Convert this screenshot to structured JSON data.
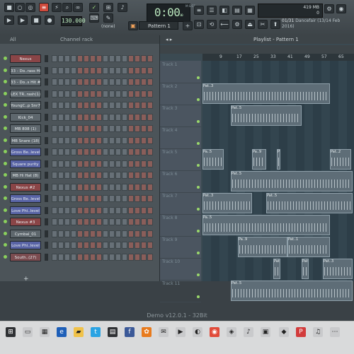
{
  "toolbar": {
    "tempo": "130.000",
    "time_main": "0:00",
    "time_small": "M:S:CS",
    "time_cs": "00",
    "pattern_label": "Pattern 1",
    "none_label": "(none)",
    "cpu_mem": "419 MB",
    "cpu_num": "0",
    "news_count": "01/31",
    "news_title": "Dancefair (13/14 Feb",
    "news_year": "2016)",
    "accent_color": "#d04a3c"
  },
  "channel_rack": {
    "filter_label": "All",
    "title": "Channel rack",
    "channels": [
      {
        "name": "Nexus",
        "color": "#8a4547"
      },
      {
        "name": "33 - Do..rass Hit",
        "color": "#5e676d"
      },
      {
        "name": "33 - Do..s Hit #2",
        "color": "#5e676d"
      },
      {
        "name": "LEX TR..rash(1)",
        "color": "#5e676d"
      },
      {
        "name": "YoungC..p Snr7",
        "color": "#5e676d"
      },
      {
        "name": "Kick_04",
        "color": "#5e676d"
      },
      {
        "name": "MB 808 (1)",
        "color": "#5e676d"
      },
      {
        "name": "MB Snare (18)",
        "color": "#5e676d"
      },
      {
        "name": "Gross Be..level",
        "color": "#5964a6"
      },
      {
        "name": "Square purity",
        "color": "#5964a6"
      },
      {
        "name": "MB Hi Hat (8)",
        "color": "#5e676d"
      },
      {
        "name": "Nexus #2",
        "color": "#8a4547"
      },
      {
        "name": "Gross Be..level",
        "color": "#5964a6"
      },
      {
        "name": "Love Phi..level",
        "color": "#5964a6"
      },
      {
        "name": "Nexus #3",
        "color": "#8a4547"
      },
      {
        "name": "Cymbal_01",
        "color": "#5e676d"
      },
      {
        "name": "Love Phi..level",
        "color": "#5964a6"
      },
      {
        "name": "South..(27)",
        "color": "#7b4c50"
      }
    ],
    "add_label": "+"
  },
  "playlist": {
    "title": "Playlist - Pattern 1",
    "ruler": [
      "9",
      "17",
      "25",
      "33",
      "41",
      "49",
      "57",
      "65"
    ],
    "tracks": [
      "Track 1",
      "Track 2",
      "Track 3",
      "Track 4",
      "Track 5",
      "Track 6",
      "Track 7",
      "Track 8",
      "Track 9",
      "Track 10",
      "Track 11"
    ],
    "clip_labels": [
      "Pat..3",
      "Pat..5",
      "Pa..5",
      "Pa..9",
      "Pat..1",
      "Pat..2",
      "Pat..5"
    ]
  },
  "status_text": "Demo v12.0.1 - 32Bit"
}
